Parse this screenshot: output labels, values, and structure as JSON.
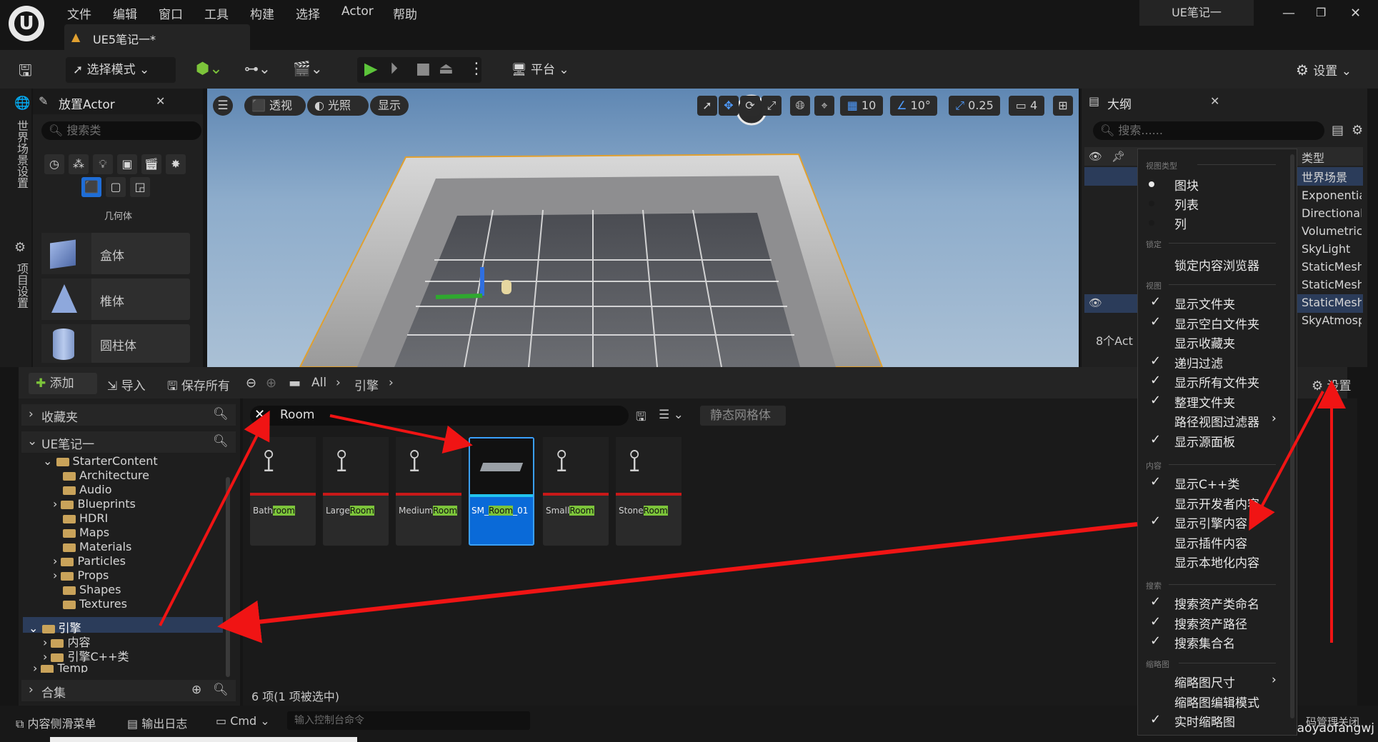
{
  "menu": [
    "文件",
    "编辑",
    "窗口",
    "工具",
    "构建",
    "选择",
    "Actor",
    "帮助"
  ],
  "doc_tab": "UE5笔记一*",
  "project_title": "UE笔记一",
  "toolbar": {
    "select_mode": "选择模式",
    "platform": "平台",
    "settings": "设置"
  },
  "left_strip": {
    "world_settings": "世界场景设置",
    "project_settings": "项目设置"
  },
  "place_actor": {
    "title": "放置Actor",
    "search_placeholder": "搜索类",
    "category": "几何体",
    "items": [
      "盒体",
      "椎体",
      "圆柱体"
    ]
  },
  "viewport": {
    "perspective": "透视",
    "lit": "光照",
    "show": "显示",
    "grid_snap": "10",
    "angle_snap": "10°",
    "scale_snap": "0.25",
    "camera_speed": "4"
  },
  "outline": {
    "title": "大纲",
    "search_placeholder": "搜索......",
    "type_header": "类型",
    "types": [
      "世界场景",
      "Exponentia",
      "Directional",
      "Volumetric",
      "SkyLight",
      "StaticMesh",
      "StaticMesh",
      "StaticMesh",
      "SkyAtmosp"
    ],
    "count": "8个Act"
  },
  "content_browser": {
    "add": "添加",
    "import": "导入",
    "save_all": "保存所有",
    "path": [
      "All",
      "引擎"
    ],
    "settings": "设置",
    "favorites": "收藏夹",
    "project": "UE笔记一",
    "tree": [
      {
        "label": "StarterContent",
        "depth": 1
      },
      {
        "label": "Architecture",
        "depth": 2
      },
      {
        "label": "Audio",
        "depth": 2
      },
      {
        "label": "Blueprints",
        "depth": 2
      },
      {
        "label": "HDRI",
        "depth": 2
      },
      {
        "label": "Maps",
        "depth": 2
      },
      {
        "label": "Materials",
        "depth": 2
      },
      {
        "label": "Particles",
        "depth": 2
      },
      {
        "label": "Props",
        "depth": 2
      },
      {
        "label": "Shapes",
        "depth": 2
      },
      {
        "label": "Textures",
        "depth": 2
      },
      {
        "label": "引擎",
        "depth": 0
      },
      {
        "label": "内容",
        "depth": 1
      },
      {
        "label": "引擎C++类",
        "depth": 1
      },
      {
        "label": "Temp",
        "depth": 0
      }
    ],
    "collections": "合集",
    "search_value": "Room",
    "filter_chip": "静态网格体",
    "assets": [
      {
        "prefix": "Bath",
        "match": "room",
        "suffix": ""
      },
      {
        "prefix": "Large",
        "match": "Room",
        "suffix": ""
      },
      {
        "prefix": "Medium",
        "match": "Room",
        "suffix": ""
      },
      {
        "prefix": "SM_",
        "match": "Room",
        "suffix": "_01"
      },
      {
        "prefix": "Small",
        "match": "Room",
        "suffix": ""
      },
      {
        "prefix": "Stone",
        "match": "Room",
        "suffix": ""
      }
    ],
    "status": "6 项(1 项被选中)"
  },
  "context_menu": {
    "sec_view_type": "视图类型",
    "view_types": [
      "图块",
      "列表",
      "列"
    ],
    "sec_lock": "锁定",
    "lock_browser": "锁定内容浏览器",
    "sec_view": "视图",
    "view_items": [
      {
        "label": "显示文件夹",
        "checked": true
      },
      {
        "label": "显示空白文件夹",
        "checked": true
      },
      {
        "label": "显示收藏夹",
        "checked": false
      },
      {
        "label": "递归过滤",
        "checked": true
      },
      {
        "label": "显示所有文件夹",
        "checked": true
      },
      {
        "label": "整理文件夹",
        "checked": true
      },
      {
        "label": "路径视图过滤器",
        "checked": false
      },
      {
        "label": "显示源面板",
        "checked": true
      }
    ],
    "sec_content": "内容",
    "content_items": [
      {
        "label": "显示C++类",
        "checked": true
      },
      {
        "label": "显示开发者内容",
        "checked": false
      },
      {
        "label": "显示引擎内容",
        "checked": true
      },
      {
        "label": "显示插件内容",
        "checked": false
      },
      {
        "label": "显示本地化内容",
        "checked": false
      }
    ],
    "sec_search": "搜索",
    "search_items": [
      {
        "label": "搜索资产类命名",
        "checked": true
      },
      {
        "label": "搜索资产路径",
        "checked": true
      },
      {
        "label": "搜索集合名",
        "checked": true
      }
    ],
    "sec_thumb": "缩略图",
    "thumb_items": [
      {
        "label": "缩略图尺寸",
        "checked": false
      },
      {
        "label": "缩略图编辑模式",
        "checked": false
      },
      {
        "label": "实时缩略图",
        "checked": true
      }
    ]
  },
  "statusbar": {
    "content_drawer": "内容侧滑菜单",
    "output_log": "输出日志",
    "cmd": "Cmd",
    "console_placeholder": "输入控制台命令",
    "source_control": "码管理关闭",
    "watermark": "CSDN @xiaoyaofangwj"
  }
}
